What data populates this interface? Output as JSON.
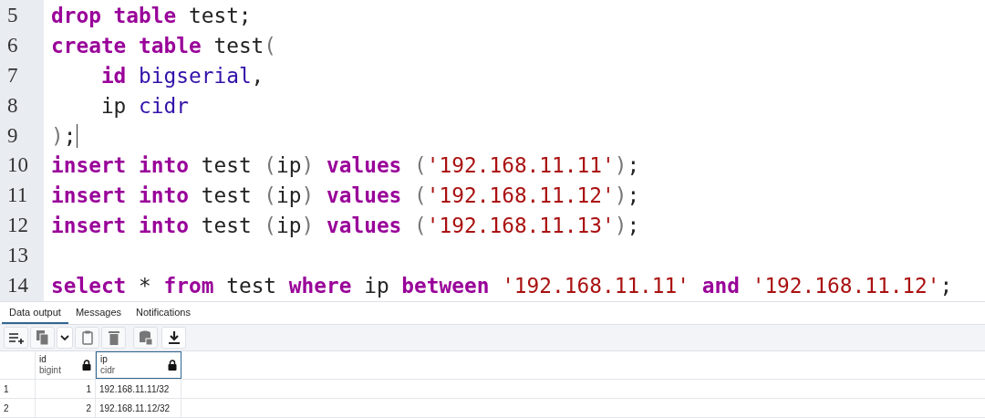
{
  "editor": {
    "lines": [
      {
        "number": "5",
        "tokens": [
          {
            "kind": "keyword",
            "text": "drop table"
          },
          {
            "kind": "plain",
            "text": " test;"
          }
        ]
      },
      {
        "number": "6",
        "tokens": [
          {
            "kind": "keyword",
            "text": "create table"
          },
          {
            "kind": "plain",
            "text": " test"
          },
          {
            "kind": "punct",
            "text": "("
          }
        ]
      },
      {
        "number": "7",
        "tokens": [
          {
            "kind": "keyword",
            "text": "    id"
          },
          {
            "kind": "type",
            "text": " bigserial"
          },
          {
            "kind": "plain",
            "text": ","
          }
        ]
      },
      {
        "number": "8",
        "tokens": [
          {
            "kind": "plain",
            "text": "    ip"
          },
          {
            "kind": "type",
            "text": " cidr"
          }
        ]
      },
      {
        "number": "9",
        "tokens": [
          {
            "kind": "punct",
            "text": ")"
          },
          {
            "kind": "plain",
            "text": ";"
          }
        ],
        "cursor": true
      },
      {
        "number": "10",
        "tokens": [
          {
            "kind": "keyword",
            "text": "insert into"
          },
          {
            "kind": "plain",
            "text": " test "
          },
          {
            "kind": "punct",
            "text": "("
          },
          {
            "kind": "plain",
            "text": "ip"
          },
          {
            "kind": "punct",
            "text": ")"
          },
          {
            "kind": "keyword",
            "text": " values "
          },
          {
            "kind": "punct",
            "text": "("
          },
          {
            "kind": "string",
            "text": "'192.168.11.11'"
          },
          {
            "kind": "punct",
            "text": ")"
          },
          {
            "kind": "plain",
            "text": ";"
          }
        ]
      },
      {
        "number": "11",
        "tokens": [
          {
            "kind": "keyword",
            "text": "insert into"
          },
          {
            "kind": "plain",
            "text": " test "
          },
          {
            "kind": "punct",
            "text": "("
          },
          {
            "kind": "plain",
            "text": "ip"
          },
          {
            "kind": "punct",
            "text": ")"
          },
          {
            "kind": "keyword",
            "text": " values "
          },
          {
            "kind": "punct",
            "text": "("
          },
          {
            "kind": "string",
            "text": "'192.168.11.12'"
          },
          {
            "kind": "punct",
            "text": ")"
          },
          {
            "kind": "plain",
            "text": ";"
          }
        ]
      },
      {
        "number": "12",
        "tokens": [
          {
            "kind": "keyword",
            "text": "insert into"
          },
          {
            "kind": "plain",
            "text": " test "
          },
          {
            "kind": "punct",
            "text": "("
          },
          {
            "kind": "plain",
            "text": "ip"
          },
          {
            "kind": "punct",
            "text": ")"
          },
          {
            "kind": "keyword",
            "text": " values "
          },
          {
            "kind": "punct",
            "text": "("
          },
          {
            "kind": "string",
            "text": "'192.168.11.13'"
          },
          {
            "kind": "punct",
            "text": ")"
          },
          {
            "kind": "plain",
            "text": ";"
          }
        ]
      },
      {
        "number": "13"
      },
      {
        "number": "14",
        "tokens": [
          {
            "kind": "keyword",
            "text": "select"
          },
          {
            "kind": "plain",
            "text": " * "
          },
          {
            "kind": "keyword",
            "text": "from"
          },
          {
            "kind": "plain",
            "text": " test "
          },
          {
            "kind": "keyword",
            "text": "where"
          },
          {
            "kind": "plain",
            "text": " ip "
          },
          {
            "kind": "keyword",
            "text": "between"
          },
          {
            "kind": "string",
            "text": " '192.168.11.11'"
          },
          {
            "kind": "keyword",
            "text": " and "
          },
          {
            "kind": "string",
            "text": "'192.168.11.12'"
          },
          {
            "kind": "plain",
            "text": ";"
          }
        ]
      }
    ]
  },
  "tabs": [
    {
      "label": "Data output",
      "selected": true
    },
    {
      "label": "Messages",
      "selected": false
    },
    {
      "label": "Notifications",
      "selected": false
    }
  ],
  "toolbar": [
    {
      "kind": "add-row",
      "disabled": false
    },
    {
      "kind": "copy",
      "disabled": true
    },
    {
      "kind": "caret",
      "disabled": false
    },
    {
      "kind": "paste",
      "disabled": true
    },
    {
      "kind": "delete",
      "disabled": true
    },
    {
      "kind": "save",
      "disabled": true
    },
    {
      "kind": "download",
      "disabled": false
    }
  ],
  "grid": {
    "columns": [
      {
        "name": "id",
        "type": "bigint",
        "selected": false
      },
      {
        "name": "ip",
        "type": "cidr",
        "selected": true
      }
    ],
    "rows": [
      {
        "number": "1",
        "cells": [
          "1",
          "192.168.11.11/32"
        ]
      },
      {
        "number": "2",
        "cells": [
          "2",
          "192.168.11.12/32"
        ]
      }
    ]
  }
}
